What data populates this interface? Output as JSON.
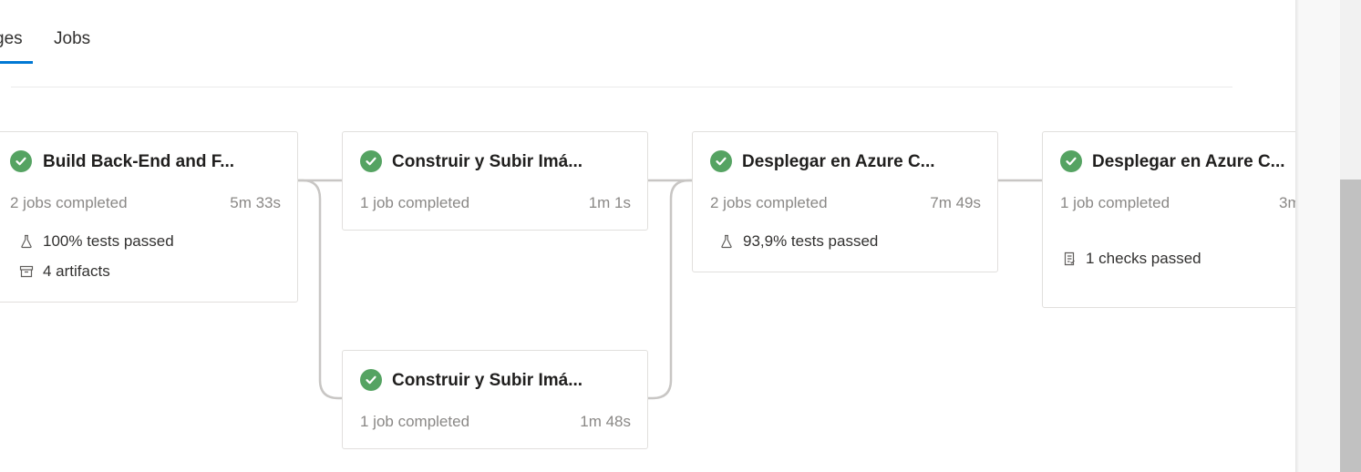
{
  "tabs": {
    "stages_label": "ges",
    "jobs_label": "Jobs"
  },
  "stages": [
    {
      "title": "Build Back-End and F...",
      "jobs": "2 jobs completed",
      "duration": "5m 33s",
      "tests": "100% tests passed",
      "artifacts": "4 artifacts"
    },
    {
      "title": "Construir y Subir Imá...",
      "jobs": "1 job completed",
      "duration": "1m 1s"
    },
    {
      "title": "Construir y Subir Imá...",
      "jobs": "1 job completed",
      "duration": "1m 48s"
    },
    {
      "title": "Desplegar en Azure C...",
      "jobs": "2 jobs completed",
      "duration": "7m 49s",
      "tests": "93,9% tests passed"
    },
    {
      "title": "Desplegar en Azure C...",
      "jobs": "1 job completed",
      "duration": "3m",
      "checks": "1 checks passed"
    }
  ],
  "colors": {
    "success": "#55a362",
    "accent": "#0078d4",
    "connector": "#c8c6c4"
  },
  "icons": {
    "status": "check-circle-icon",
    "tests": "beaker-icon",
    "artifacts": "archive-box-icon",
    "checks": "checklist-icon"
  }
}
